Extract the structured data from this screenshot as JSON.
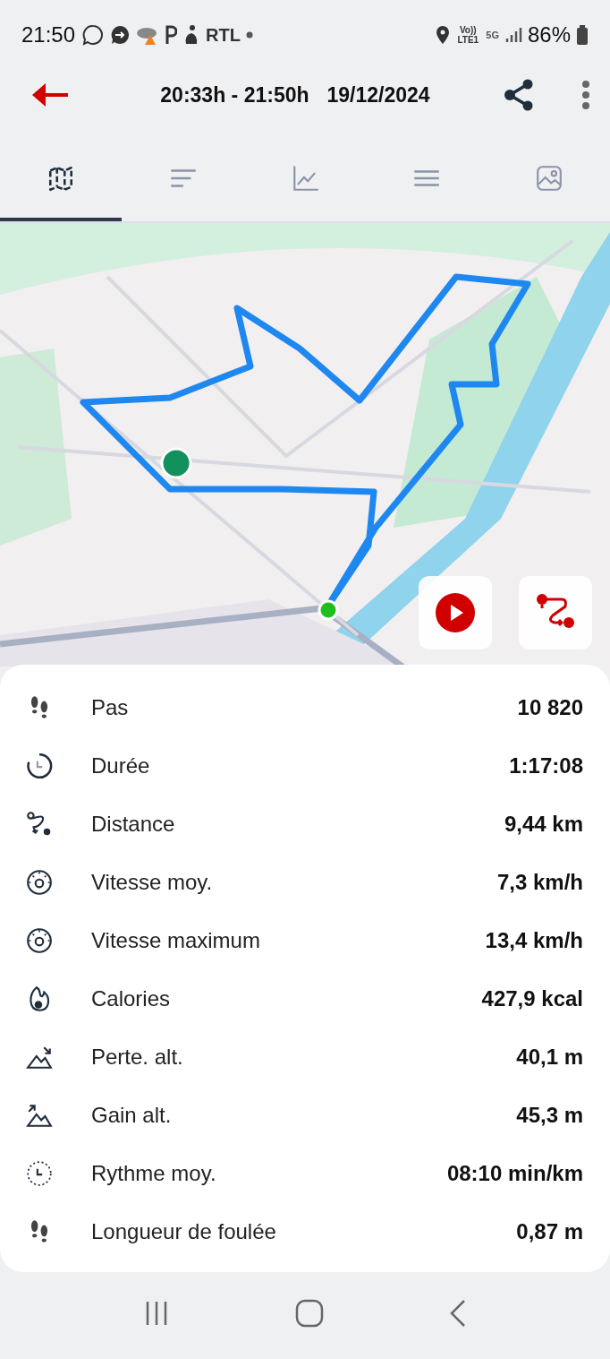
{
  "status_bar": {
    "time": "21:50",
    "app_label": "RTL",
    "network": "Vo)) LTE1",
    "mobile_data": "5G",
    "battery": "86%"
  },
  "header": {
    "time_range": "20:33h - 21:50h",
    "date": "19/12/2024"
  },
  "tabs": [
    {
      "kind": "map",
      "selected": true
    },
    {
      "kind": "summary",
      "selected": false
    },
    {
      "kind": "chart",
      "selected": false
    },
    {
      "kind": "list",
      "selected": false
    },
    {
      "kind": "photos",
      "selected": false
    }
  ],
  "stats": [
    {
      "kind": "steps",
      "label": "Pas",
      "value": "10 820"
    },
    {
      "kind": "duration",
      "label": "Durée",
      "value": "1:17:08"
    },
    {
      "kind": "distance",
      "label": "Distance",
      "value": "9,44 km"
    },
    {
      "kind": "speed",
      "label": "Vitesse moy.",
      "value": "7,3 km/h"
    },
    {
      "kind": "maxspeed",
      "label": "Vitesse maximum",
      "value": "13,4 km/h"
    },
    {
      "kind": "calories",
      "label": "Calories",
      "value": "427,9 kcal"
    },
    {
      "kind": "descent",
      "label": "Perte. alt.",
      "value": "40,1 m"
    },
    {
      "kind": "ascent",
      "label": "Gain alt.",
      "value": "45,3 m"
    },
    {
      "kind": "pace",
      "label": "Rythme moy.",
      "value": "08:10 min/km"
    },
    {
      "kind": "stride",
      "label": "Longueur de foulée",
      "value": "0,87 m"
    }
  ]
}
